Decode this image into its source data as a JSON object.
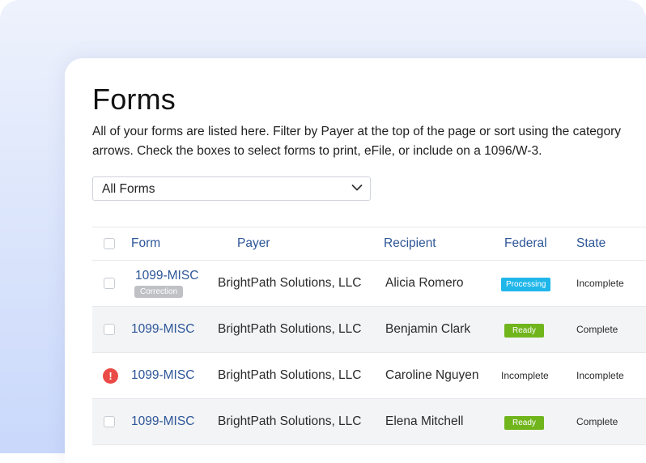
{
  "page": {
    "title": "Forms",
    "description": "All of your forms are listed here. Filter by Payer at the top of the page or sort using the category arrows. Check the boxes to select forms to print, eFile, or include on a 1096/W-3."
  },
  "filter": {
    "selected": "All Forms",
    "icon": "chevron-down-icon"
  },
  "table": {
    "columns": {
      "form": "Form",
      "payer": "Payer",
      "recipient": "Recipient",
      "federal": "Federal",
      "state": "State"
    },
    "rows": [
      {
        "form": "1099-MISC",
        "badge": "Correction",
        "payer": "BrightPath Solutions, LLC",
        "recipient": "Alicia Romero",
        "federal": "Processing",
        "state": "Incomplete"
      },
      {
        "form": "1099-MISC",
        "payer": "BrightPath Solutions, LLC",
        "recipient": "Benjamin Clark",
        "federal": "Ready",
        "state": "Complete"
      },
      {
        "form": "1099-MISC",
        "alert": "!",
        "payer": "BrightPath Solutions, LLC",
        "recipient": "Caroline Nguyen",
        "federal": "Incomplete",
        "state": "Incomplete"
      },
      {
        "form": "1099-MISC",
        "payer": "BrightPath Solutions, LLC",
        "recipient": "Elena Mitchell",
        "federal": "Ready",
        "state": "Complete"
      }
    ]
  },
  "colors": {
    "link": "#2d5698",
    "processing": "#1fb6ea",
    "ready": "#71b51d",
    "alert": "#ea4b46",
    "correction": "#bfc1c5"
  }
}
